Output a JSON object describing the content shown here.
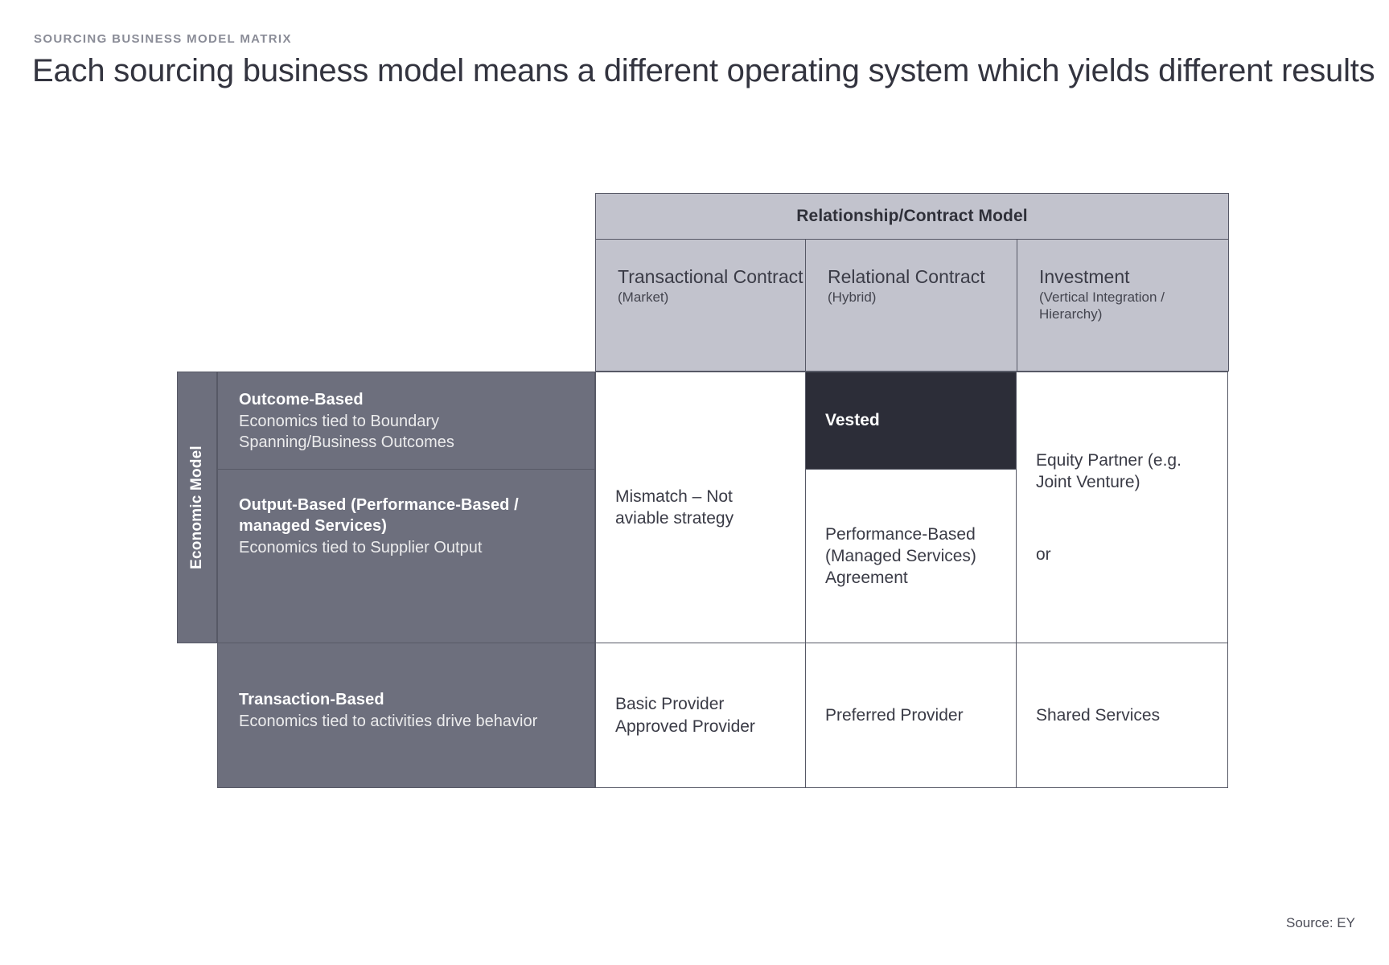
{
  "header": {
    "kicker": "SOURCING BUSINESS MODEL MATRIX",
    "title": "Each sourcing business model means a different operating system which yields different results"
  },
  "matrix": {
    "column_group_title": "Relationship/Contract Model",
    "row_axis_label": "Economic Model",
    "columns": [
      {
        "name": "Transactional Contract",
        "qualifier": "(Market)"
      },
      {
        "name": "Relational Contract",
        "qualifier": "(Hybrid)"
      },
      {
        "name": "Investment",
        "qualifier": "(Vertical Integration / Hierarchy)"
      }
    ],
    "rows": [
      {
        "title": "Outcome-Based",
        "description": "Economics tied to Boundary Spanning/Business Outcomes"
      },
      {
        "title": "Output-Based (Performance-Based / managed Services)",
        "description": "Economics tied to Supplier Output"
      },
      {
        "title": "Transaction-Based",
        "description": "Economics tied to activities drive behavior"
      }
    ],
    "cells": {
      "transactional_merged": "Mismatch – Not aviable strategy",
      "relational_outcome": "Vested",
      "relational_output": "Performance-Based (Managed Services) Agreement",
      "investment_merged_top": "Equity Partner (e.g. Joint Venture)",
      "investment_merged_or": "or",
      "transactional_transaction": "Basic Provider Approved Provider",
      "relational_transaction": "Preferred Provider",
      "investment_transaction": "Shared Services"
    },
    "colors": {
      "header_fill": "#c2c3cd",
      "row_label_fill": "#6d6f7d",
      "highlight_fill": "#2c2d38",
      "border": "#575966"
    }
  },
  "footer": {
    "source": "Source: EY"
  }
}
